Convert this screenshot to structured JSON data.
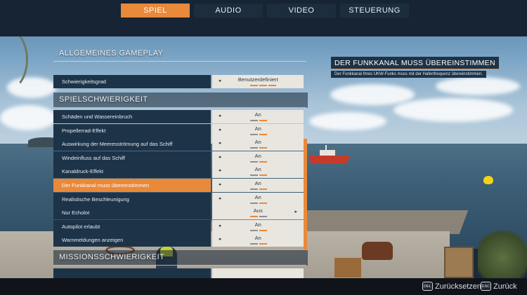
{
  "tabs": [
    {
      "label": "SPIEL",
      "active": true
    },
    {
      "label": "AUDIO",
      "active": false
    },
    {
      "label": "VIDEO",
      "active": false
    },
    {
      "label": "STEUERUNG",
      "active": false
    }
  ],
  "sections": {
    "general": {
      "title": "ALLGEMEINES GAMEPLAY",
      "rows": [
        {
          "label": "Schwierigkeitsgrad",
          "value": "Benutzerdefiniert",
          "left_arrow": true,
          "right_arrow": false,
          "level": "3 of 3 bars lit",
          "bars": [
            1,
            1,
            1
          ]
        }
      ]
    },
    "difficulty": {
      "title": "SPIELSCHWIERIGKEIT",
      "rows": [
        {
          "label": "Schäden und Wassereinbruch",
          "value": "An",
          "left_arrow": true,
          "right_arrow": false,
          "bars": [
            0,
            1
          ]
        },
        {
          "label": "Propellerrad-Effekt",
          "value": "An",
          "left_arrow": true,
          "right_arrow": false,
          "bars": [
            0,
            1
          ]
        },
        {
          "label": "Auswirkung der Meeresströmung auf das Schiff",
          "value": "An",
          "left_arrow": true,
          "right_arrow": false,
          "bars": [
            0,
            1
          ]
        },
        {
          "label": "Windeinfluss auf das Schiff",
          "value": "An",
          "left_arrow": true,
          "right_arrow": false,
          "bars": [
            0,
            1
          ]
        },
        {
          "label": "Kanaldruck-Effekt",
          "value": "An",
          "left_arrow": true,
          "right_arrow": false,
          "bars": [
            0,
            1
          ]
        },
        {
          "label": "Der Funkkanal muss übereinstimmen",
          "value": "An",
          "left_arrow": true,
          "right_arrow": false,
          "bars": [
            0,
            1
          ],
          "selected": true
        },
        {
          "label": "Realistische Beschleunigung",
          "value": "An",
          "left_arrow": true,
          "right_arrow": false,
          "bars": [
            0,
            1
          ]
        },
        {
          "label": "Nur Echolot",
          "value": "Aus",
          "left_arrow": false,
          "right_arrow": true,
          "bars": [
            1,
            0
          ]
        },
        {
          "label": "Autopilot erlaubt",
          "value": "An",
          "left_arrow": true,
          "right_arrow": false,
          "bars": [
            0,
            1
          ]
        },
        {
          "label": "Warnmeldungen anzeigen",
          "value": "An",
          "left_arrow": true,
          "right_arrow": false,
          "bars": [
            0,
            1
          ]
        }
      ]
    },
    "mission": {
      "title": "MISSIONSSCHWIERIGKEIT"
    }
  },
  "info": {
    "title": "DER FUNKKANAL MUSS ÜBEREINSTIMMEN",
    "text": "Der Funkkanal Ihres UKW-Funks muss mit der Hafenfrequenz übereinstimmen."
  },
  "footer": {
    "reset": {
      "key": "DEL",
      "label": "Zurücksetzen"
    },
    "back": {
      "key": "ESC",
      "label": "Zurück"
    }
  },
  "icons": {
    "arrow_left": "◂",
    "arrow_right": "▸"
  },
  "colors": {
    "accent": "#e9893a",
    "panel": "#1d3347",
    "control": "#e9e6e0"
  }
}
